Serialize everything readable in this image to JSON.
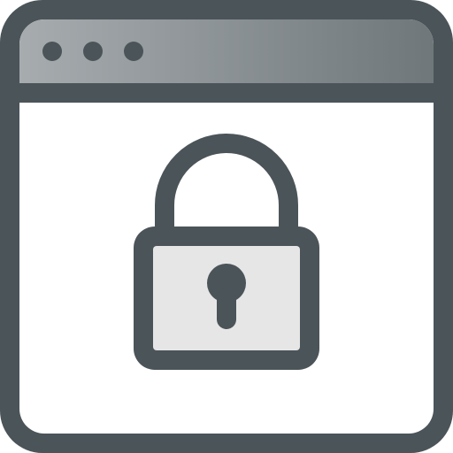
{
  "icon": {
    "name": "browser-window-lock-icon",
    "parts": {
      "window": "browser-window-icon",
      "titlebar_dots": [
        "window-dot-icon",
        "window-dot-icon",
        "window-dot-icon"
      ],
      "lock": "padlock-icon",
      "keyhole": "keyhole-icon"
    }
  },
  "colors": {
    "outline": "#4b5459",
    "titlebar_light": "#a7acaf",
    "titlebar_dark": "#6f777b",
    "window_body": "#ffffff",
    "lock_body": "#e6e6e6"
  }
}
